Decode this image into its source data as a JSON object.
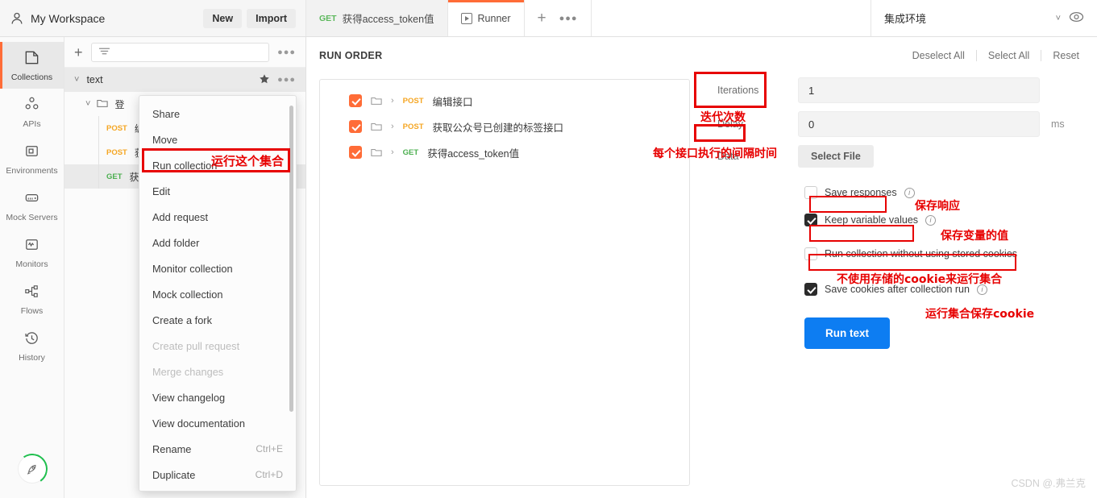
{
  "topbar": {
    "workspace_name": "My Workspace",
    "new_label": "New",
    "import_label": "Import",
    "tabs": [
      {
        "method": "GET",
        "label": "获得access_token值",
        "active": false
      },
      {
        "method": "",
        "label": "Runner",
        "active": true
      }
    ],
    "add_tab_icon": "plus-icon",
    "tab_options_icon": "more-options-icon",
    "environment": "集成环境",
    "env_chevron_icon": "chevron-down-icon",
    "eye_icon": "eye-icon"
  },
  "rail": {
    "items": [
      {
        "label": "Collections",
        "icon": "collections-icon",
        "active": true
      },
      {
        "label": "APIs",
        "icon": "apis-icon",
        "active": false
      },
      {
        "label": "Environments",
        "icon": "environments-icon",
        "active": false
      },
      {
        "label": "Mock Servers",
        "icon": "mock-servers-icon",
        "active": false
      },
      {
        "label": "Monitors",
        "icon": "monitors-icon",
        "active": false
      },
      {
        "label": "Flows",
        "icon": "flows-icon",
        "active": false
      },
      {
        "label": "History",
        "icon": "history-icon",
        "active": false
      }
    ]
  },
  "sidebar": {
    "new_icon": "plus-icon",
    "filter_placeholder": "",
    "filter_icon": "filter-icon",
    "options_icon": "more-options-icon",
    "collection": {
      "name": "text",
      "star_icon": "star-icon",
      "options_icon": "more-options-icon"
    },
    "folder": {
      "name": "登"
    },
    "requests": [
      {
        "method": "POST",
        "name": "编"
      },
      {
        "method": "POST",
        "name": "获"
      },
      {
        "method": "GET",
        "name": "获"
      }
    ]
  },
  "context_menu": {
    "items": [
      {
        "label": "Share",
        "shortcut": "",
        "disabled": false
      },
      {
        "label": "Move",
        "shortcut": "",
        "disabled": false
      },
      {
        "label": "Run collection",
        "shortcut": "",
        "disabled": false
      },
      {
        "label": "Edit",
        "shortcut": "",
        "disabled": false
      },
      {
        "label": "Add request",
        "shortcut": "",
        "disabled": false
      },
      {
        "label": "Add folder",
        "shortcut": "",
        "disabled": false
      },
      {
        "label": "Monitor collection",
        "shortcut": "",
        "disabled": false
      },
      {
        "label": "Mock collection",
        "shortcut": "",
        "disabled": false
      },
      {
        "label": "Create a fork",
        "shortcut": "",
        "disabled": false
      },
      {
        "label": "Create pull request",
        "shortcut": "",
        "disabled": true
      },
      {
        "label": "Merge changes",
        "shortcut": "",
        "disabled": true
      },
      {
        "label": "View changelog",
        "shortcut": "",
        "disabled": false
      },
      {
        "label": "View documentation",
        "shortcut": "",
        "disabled": false
      },
      {
        "label": "Rename",
        "shortcut": "Ctrl+E",
        "disabled": false
      },
      {
        "label": "Duplicate",
        "shortcut": "Ctrl+D",
        "disabled": false
      }
    ]
  },
  "runner": {
    "run_order_title": "RUN ORDER",
    "actions": [
      "Deselect All",
      "Select All",
      "Reset"
    ],
    "rows": [
      {
        "checked": true,
        "method": "POST",
        "name": "编辑接口"
      },
      {
        "checked": true,
        "method": "POST",
        "name": "获取公众号已创建的标签接口"
      },
      {
        "checked": true,
        "method": "GET",
        "name": "获得access_token值"
      }
    ],
    "config": {
      "iterations_label": "Iterations",
      "iterations_value": "1",
      "delay_label": "Delay",
      "delay_value": "0",
      "delay_unit": "ms",
      "data_label": "Data",
      "select_file_label": "Select File",
      "options": [
        {
          "label": "Save responses",
          "checked": false,
          "info": true
        },
        {
          "label": "Keep variable values",
          "checked": true,
          "info": true
        },
        {
          "label": "Run collection without using stored cookies",
          "checked": false,
          "info": false
        },
        {
          "label": "Save cookies after collection run",
          "checked": true,
          "info": true
        }
      ],
      "run_button_label": "Run text"
    }
  },
  "annotations": {
    "run_collection_note": "运行这个集合",
    "iterations_note": "迭代次数",
    "delay_note": "每个接口执行的间隔时间",
    "save_responses_note": "保存响应",
    "keep_variable_values_note": "保存变量的值",
    "no_cookies_note": "不使用存储的cookie来运行集合",
    "save_cookies_note": "运行集合保存cookie"
  },
  "watermark": "CSDN @.弗兰克",
  "colors": {
    "accent_orange": "#ff6c37",
    "annotation_red": "#e70000",
    "run_button_blue": "#0d7df2",
    "get_green": "#4caf50",
    "post_yellow": "#f5a623"
  }
}
